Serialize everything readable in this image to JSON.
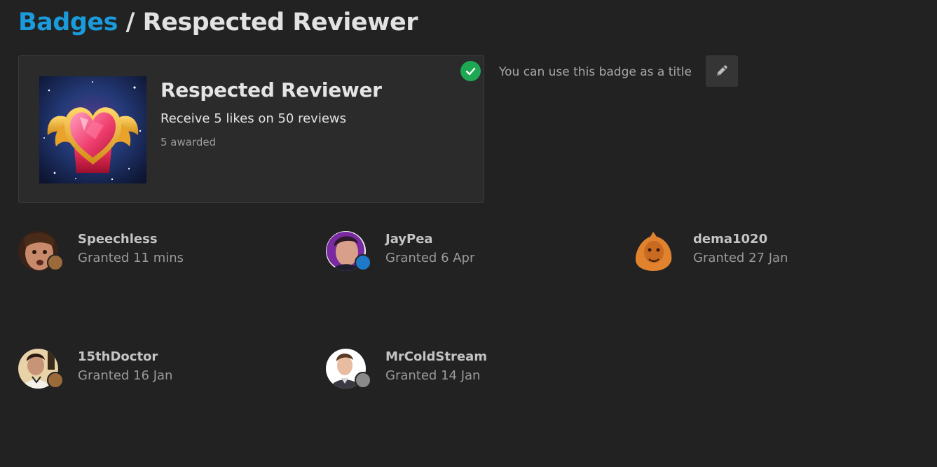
{
  "breadcrumb": {
    "parent": "Badges",
    "separator": "/",
    "current": "Respected Reviewer"
  },
  "badge": {
    "name": "Respected Reviewer",
    "description": "Receive 5 likes on 50 reviews",
    "awarded": "5 awarded",
    "owned_icon": "check-icon",
    "image_icon": "winged-heart-gem-icon"
  },
  "title_note": "You can use this badge as a title",
  "edit_icon": "pencil-icon",
  "colors": {
    "background": "#222222",
    "card": "#2b2b2b",
    "link": "#1a9bdb",
    "check": "#1ea854"
  },
  "users": [
    {
      "name": "Speechless",
      "granted": "Granted 11 mins",
      "badge_tier": "bronze"
    },
    {
      "name": "JayPea",
      "granted": "Granted 6 Apr",
      "badge_tier": "blue"
    },
    {
      "name": "dema1020",
      "granted": "Granted 27 Jan",
      "badge_tier": "none"
    },
    {
      "name": "15thDoctor",
      "granted": "Granted 16 Jan",
      "badge_tier": "bronze"
    },
    {
      "name": "MrColdStream",
      "granted": "Granted 14 Jan",
      "badge_tier": "silver"
    }
  ]
}
